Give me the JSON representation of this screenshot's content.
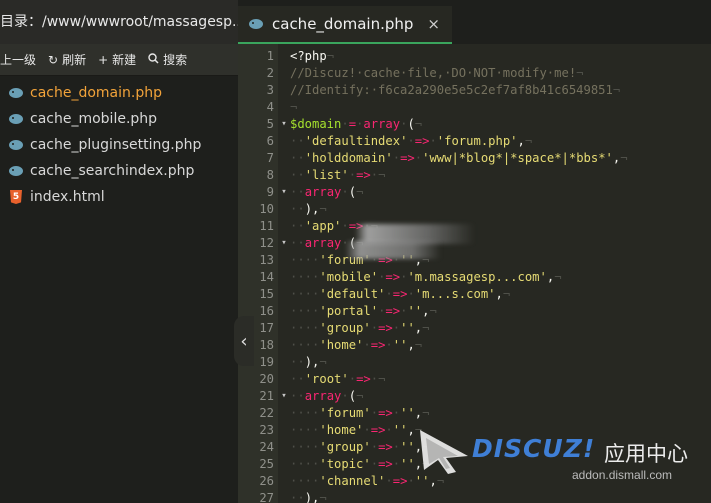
{
  "sidebar": {
    "path": "目录：/www/wwwroot/massagesp...",
    "toolbar": {
      "up": {
        "icon": "up-arrow-icon",
        "label": "上一级"
      },
      "refresh": {
        "icon": "refresh-icon",
        "label": "刷新"
      },
      "new": {
        "icon": "plus-icon",
        "label": "新建"
      },
      "search": {
        "icon": "search-icon",
        "label": "搜索"
      }
    },
    "files": [
      {
        "name": "cache_domain.php",
        "type": "php",
        "active": true
      },
      {
        "name": "cache_mobile.php",
        "type": "php"
      },
      {
        "name": "cache_pluginsetting.php",
        "type": "php"
      },
      {
        "name": "cache_searchindex.php",
        "type": "php"
      },
      {
        "name": "index.html",
        "type": "html",
        "badge": "5"
      }
    ],
    "collapse_glyph": "‹"
  },
  "tab": {
    "title": "cache_domain.php",
    "close": "×"
  },
  "editor": {
    "theme_colors": {
      "comment": "#75715e",
      "variable": "#a6e22e",
      "keyword": "#f92672",
      "string": "#e6db74",
      "text": "#f8f8f2"
    },
    "lines": [
      {
        "n": "1",
        "tokens": [
          [
            "p",
            "<?php"
          ],
          [
            "w",
            "¬"
          ]
        ]
      },
      {
        "n": "2",
        "tokens": [
          [
            "c",
            "//Discuz!·cache·file,·DO·NOT·modify·me!"
          ],
          [
            "w",
            "¬"
          ]
        ]
      },
      {
        "n": "3",
        "tokens": [
          [
            "c",
            "//Identify:·f6ca2a290e5e5c2ef7af8b41c6549851"
          ],
          [
            "w",
            "¬"
          ]
        ]
      },
      {
        "n": "4",
        "tokens": [
          [
            "w",
            "¬"
          ]
        ]
      },
      {
        "n": "5",
        "fold": true,
        "tokens": [
          [
            "v",
            "$domain"
          ],
          [
            "w",
            "·"
          ],
          [
            "o",
            "="
          ],
          [
            "w",
            "·"
          ],
          [
            "k",
            "array"
          ],
          [
            "w",
            "·"
          ],
          [
            "p",
            "("
          ],
          [
            "w",
            "¬"
          ]
        ]
      },
      {
        "n": "6",
        "tokens": [
          [
            "w",
            "··"
          ],
          [
            "s",
            "'defaultindex'"
          ],
          [
            "w",
            "·"
          ],
          [
            "o",
            "=>"
          ],
          [
            "w",
            "·"
          ],
          [
            "s",
            "'forum.php'"
          ],
          [
            "p",
            ","
          ],
          [
            "w",
            "¬"
          ]
        ]
      },
      {
        "n": "7",
        "tokens": [
          [
            "w",
            "··"
          ],
          [
            "s",
            "'holddomain'"
          ],
          [
            "w",
            "·"
          ],
          [
            "o",
            "=>"
          ],
          [
            "w",
            "·"
          ],
          [
            "s",
            "'www|*blog*|*space*|*bbs*'"
          ],
          [
            "p",
            ","
          ],
          [
            "w",
            "¬"
          ]
        ]
      },
      {
        "n": "8",
        "tokens": [
          [
            "w",
            "··"
          ],
          [
            "s",
            "'list'"
          ],
          [
            "w",
            "·"
          ],
          [
            "o",
            "=>"
          ],
          [
            "w",
            "·¬"
          ]
        ]
      },
      {
        "n": "9",
        "fold": true,
        "tokens": [
          [
            "w",
            "··"
          ],
          [
            "k",
            "array"
          ],
          [
            "w",
            "·"
          ],
          [
            "p",
            "("
          ],
          [
            "w",
            "¬"
          ]
        ]
      },
      {
        "n": "10",
        "tokens": [
          [
            "w",
            "··"
          ],
          [
            "p",
            "),"
          ],
          [
            "w",
            "¬"
          ]
        ]
      },
      {
        "n": "11",
        "tokens": [
          [
            "w",
            "··"
          ],
          [
            "s",
            "'app'"
          ],
          [
            "w",
            "·"
          ],
          [
            "o",
            "=>"
          ],
          [
            "w",
            "·¬"
          ]
        ]
      },
      {
        "n": "12",
        "fold": true,
        "tokens": [
          [
            "w",
            "··"
          ],
          [
            "k",
            "array"
          ],
          [
            "w",
            "·"
          ],
          [
            "p",
            "("
          ],
          [
            "w",
            "¬"
          ]
        ]
      },
      {
        "n": "13",
        "tokens": [
          [
            "w",
            "····"
          ],
          [
            "s",
            "'forum'"
          ],
          [
            "w",
            "·"
          ],
          [
            "o",
            "=>"
          ],
          [
            "w",
            "·"
          ],
          [
            "s",
            "''"
          ],
          [
            "p",
            ","
          ],
          [
            "w",
            "¬"
          ]
        ]
      },
      {
        "n": "14",
        "tokens": [
          [
            "w",
            "····"
          ],
          [
            "s",
            "'mobile'"
          ],
          [
            "w",
            "·"
          ],
          [
            "o",
            "=>"
          ],
          [
            "w",
            "·"
          ],
          [
            "s",
            "'m.massagesp...com'"
          ],
          [
            "p",
            ","
          ],
          [
            "w",
            "¬"
          ]
        ]
      },
      {
        "n": "15",
        "tokens": [
          [
            "w",
            "····"
          ],
          [
            "s",
            "'default'"
          ],
          [
            "w",
            "·"
          ],
          [
            "o",
            "=>"
          ],
          [
            "w",
            "·"
          ],
          [
            "s",
            "'m...s.com'"
          ],
          [
            "p",
            ","
          ],
          [
            "w",
            "¬"
          ]
        ]
      },
      {
        "n": "16",
        "tokens": [
          [
            "w",
            "····"
          ],
          [
            "s",
            "'portal'"
          ],
          [
            "w",
            "·"
          ],
          [
            "o",
            "=>"
          ],
          [
            "w",
            "·"
          ],
          [
            "s",
            "''"
          ],
          [
            "p",
            ","
          ],
          [
            "w",
            "¬"
          ]
        ]
      },
      {
        "n": "17",
        "tokens": [
          [
            "w",
            "····"
          ],
          [
            "s",
            "'group'"
          ],
          [
            "w",
            "·"
          ],
          [
            "o",
            "=>"
          ],
          [
            "w",
            "·"
          ],
          [
            "s",
            "''"
          ],
          [
            "p",
            ","
          ],
          [
            "w",
            "¬"
          ]
        ]
      },
      {
        "n": "18",
        "tokens": [
          [
            "w",
            "····"
          ],
          [
            "s",
            "'home'"
          ],
          [
            "w",
            "·"
          ],
          [
            "o",
            "=>"
          ],
          [
            "w",
            "·"
          ],
          [
            "s",
            "''"
          ],
          [
            "p",
            ","
          ],
          [
            "w",
            "¬"
          ]
        ]
      },
      {
        "n": "19",
        "tokens": [
          [
            "w",
            "··"
          ],
          [
            "p",
            "),"
          ],
          [
            "w",
            "¬"
          ]
        ]
      },
      {
        "n": "20",
        "tokens": [
          [
            "w",
            "··"
          ],
          [
            "s",
            "'root'"
          ],
          [
            "w",
            "·"
          ],
          [
            "o",
            "=>"
          ],
          [
            "w",
            "·¬"
          ]
        ]
      },
      {
        "n": "21",
        "fold": true,
        "tokens": [
          [
            "w",
            "··"
          ],
          [
            "k",
            "array"
          ],
          [
            "w",
            "·"
          ],
          [
            "p",
            "("
          ],
          [
            "w",
            "¬"
          ]
        ]
      },
      {
        "n": "22",
        "tokens": [
          [
            "w",
            "····"
          ],
          [
            "s",
            "'forum'"
          ],
          [
            "w",
            "·"
          ],
          [
            "o",
            "=>"
          ],
          [
            "w",
            "·"
          ],
          [
            "s",
            "''"
          ],
          [
            "p",
            ","
          ],
          [
            "w",
            "¬"
          ]
        ]
      },
      {
        "n": "23",
        "tokens": [
          [
            "w",
            "····"
          ],
          [
            "s",
            "'home'"
          ],
          [
            "w",
            "·"
          ],
          [
            "o",
            "=>"
          ],
          [
            "w",
            "·"
          ],
          [
            "s",
            "''"
          ],
          [
            "p",
            ","
          ],
          [
            "w",
            "¬"
          ]
        ]
      },
      {
        "n": "24",
        "tokens": [
          [
            "w",
            "····"
          ],
          [
            "s",
            "'group'"
          ],
          [
            "w",
            "·"
          ],
          [
            "o",
            "=>"
          ],
          [
            "w",
            "·"
          ],
          [
            "s",
            "''"
          ],
          [
            "p",
            ","
          ],
          [
            "w",
            "¬"
          ]
        ]
      },
      {
        "n": "25",
        "tokens": [
          [
            "w",
            "····"
          ],
          [
            "s",
            "'topic'"
          ],
          [
            "w",
            "·"
          ],
          [
            "o",
            "=>"
          ],
          [
            "w",
            "·"
          ],
          [
            "s",
            "''"
          ],
          [
            "p",
            ","
          ],
          [
            "w",
            "¬"
          ]
        ]
      },
      {
        "n": "26",
        "tokens": [
          [
            "w",
            "····"
          ],
          [
            "s",
            "'channel'"
          ],
          [
            "w",
            "·"
          ],
          [
            "o",
            "=>"
          ],
          [
            "w",
            "·"
          ],
          [
            "s",
            "''"
          ],
          [
            "p",
            ","
          ],
          [
            "w",
            "¬"
          ]
        ]
      },
      {
        "n": "27",
        "tokens": [
          [
            "w",
            "··"
          ],
          [
            "p",
            "),"
          ],
          [
            "w",
            "¬"
          ]
        ]
      }
    ]
  },
  "watermark": {
    "brand": "DISCUZ!",
    "cn": "应用中心",
    "url": "addon.dismall.com"
  }
}
